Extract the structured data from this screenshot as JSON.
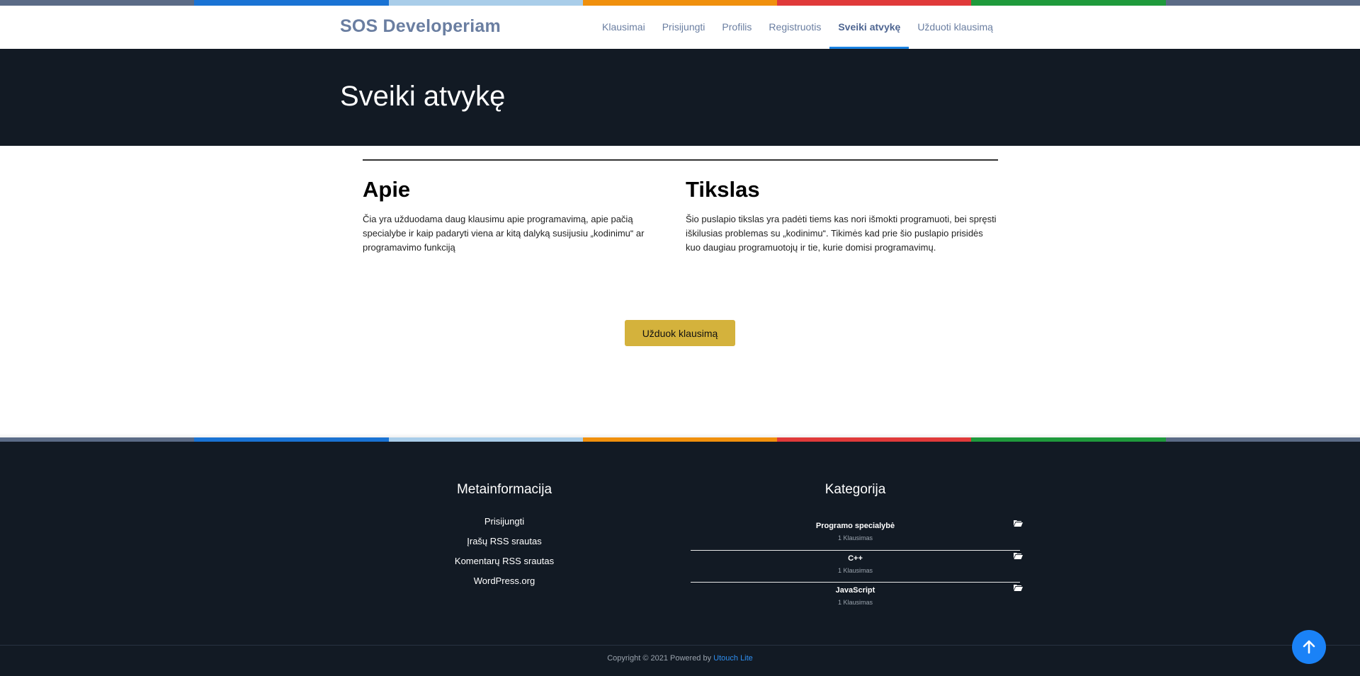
{
  "colors": {
    "stripe": [
      "#5b6b86",
      "#1a73d4",
      "#a9cde9",
      "#f0900d",
      "#e03a3a",
      "#1f9a3c",
      "#5b6b86"
    ],
    "hero_bg": "#121a24",
    "accent_button": "#d4b23c",
    "nav_active_underline": "#1a82e2",
    "to_top": "#1a82f7"
  },
  "header": {
    "brand": "SOS Developeriam",
    "nav": [
      {
        "label": "Klausimai",
        "active": false
      },
      {
        "label": "Prisijungti",
        "active": false
      },
      {
        "label": "Profilis",
        "active": false
      },
      {
        "label": "Registruotis",
        "active": false
      },
      {
        "label": "Sveiki atvykę",
        "active": true
      },
      {
        "label": "Užduoti klausimą",
        "active": false
      }
    ]
  },
  "hero": {
    "title": "Sveiki atvykę"
  },
  "main": {
    "about": {
      "heading": "Apie",
      "text": "Čia yra užduodama  daug klausimu apie programavimą, apie pačią specialybe ir kaip padaryti viena ar kitą dalyką susijusiu „kodinimu“ ar programavimo funkciją"
    },
    "goal": {
      "heading": "Tikslas",
      "text": "Šio puslapio tikslas yra padėti tiems kas nori išmokti programuoti, bei spręsti iškilusias problemas su „kodinimu“. Tikimės kad prie šio puslapio prisidės kuo daugiau programuotojų ir tie, kurie domisi programavimų."
    },
    "ask_button": "Užduok klausimą"
  },
  "footer": {
    "meta": {
      "heading": "Metainformacija",
      "links": [
        "Prisijungti",
        "Įrašų RSS srautas",
        "Komentarų RSS srautas",
        "WordPress.org"
      ]
    },
    "categories": {
      "heading": "Kategorija",
      "items": [
        {
          "name": "Programo specialybė",
          "count": "1 Klausimas",
          "icon": "folder-open-icon"
        },
        {
          "name": "C++",
          "count": "1 Klausimas",
          "icon": "folder-open-icon"
        },
        {
          "name": "JavaScript",
          "count": "1 Klausimas",
          "icon": "folder-open-icon"
        }
      ]
    },
    "copyright_prefix": "Copyright © 2021 Powered by ",
    "copyright_link": "Utouch Lite",
    "to_top_icon": "arrow-up-icon"
  }
}
